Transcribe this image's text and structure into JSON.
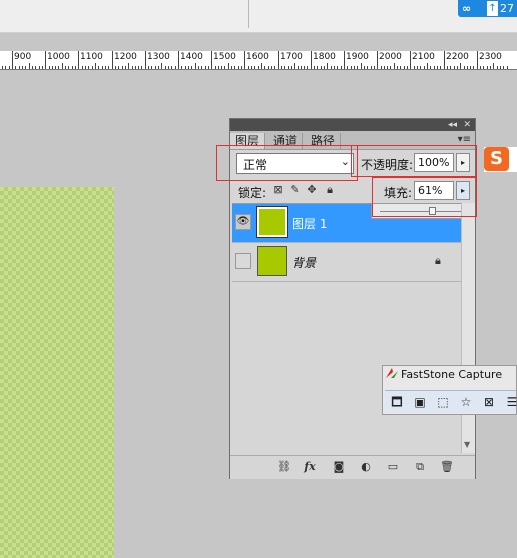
{
  "top": {
    "badge_count": "27",
    "badge_arrow": "↑"
  },
  "ruler": {
    "labels": [
      "900",
      "1000",
      "1100",
      "1200",
      "1300",
      "1400",
      "1500",
      "1600",
      "1700",
      "1800",
      "1900",
      "2000",
      "2100",
      "2200",
      "2300"
    ]
  },
  "panel": {
    "tabs": [
      "图层",
      "通道",
      "路径"
    ],
    "blend_mode": "正常",
    "opacity_label": "不透明度:",
    "opacity_value": "100%",
    "lock_label": "锁定:",
    "fill_label": "填充:",
    "fill_value": "61%",
    "fill_fraction": 0.61,
    "layers": [
      {
        "name": "图层 1",
        "selected": true,
        "visible": true,
        "thumb_color": "#a8c800"
      },
      {
        "name": "背景",
        "selected": false,
        "visible": false,
        "locked": true,
        "thumb_color": "#a8c800"
      }
    ],
    "footer_icons": [
      "link-icon",
      "fx-icon",
      "mask-icon",
      "adjustment-icon",
      "folder-icon",
      "new-layer-icon",
      "trash-icon"
    ],
    "footer_fx": "fx"
  },
  "faststone": {
    "title": "FastStone Capture"
  },
  "sogou": {
    "letter": "S"
  },
  "colors": {
    "selection": "#3399ff",
    "highlight": "#e03030",
    "layer_fill": "#a8c800"
  }
}
